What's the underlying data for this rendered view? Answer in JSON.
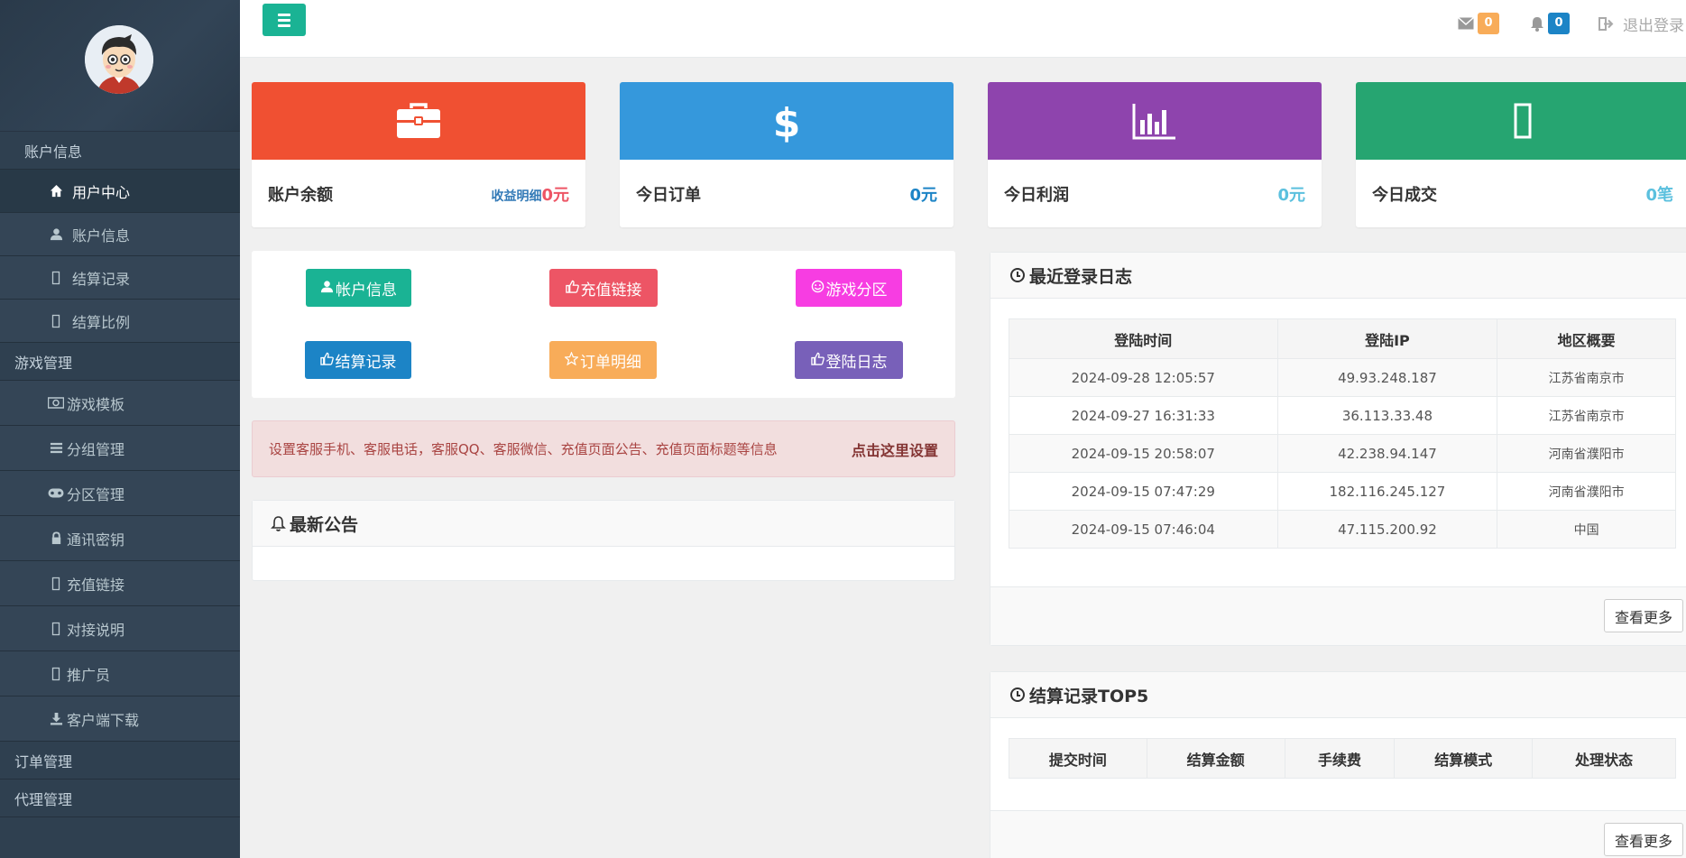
{
  "sidebar": {
    "items": [
      {
        "label": "账户信息",
        "icon": "",
        "type": "section"
      },
      {
        "label": "用户中心",
        "icon": "home-icon",
        "type": "sub-active"
      },
      {
        "label": "账户信息",
        "icon": "user-icon",
        "type": "sub"
      },
      {
        "label": "结算记录",
        "icon": "missing-glyph-icon",
        "type": "sub"
      },
      {
        "label": "结算比例",
        "icon": "missing-glyph-icon",
        "type": "sub"
      },
      {
        "label": "游戏管理",
        "icon": "",
        "type": "section"
      },
      {
        "label": "游戏模板",
        "icon": "money-icon",
        "type": "sub2"
      },
      {
        "label": "分组管理",
        "icon": "list-icon",
        "type": "sub2"
      },
      {
        "label": "分区管理",
        "icon": "gamepad-icon",
        "type": "sub2"
      },
      {
        "label": "通讯密钥",
        "icon": "lock-icon",
        "type": "sub2"
      },
      {
        "label": "充值链接",
        "icon": "missing-glyph-icon",
        "type": "sub2"
      },
      {
        "label": "对接说明",
        "icon": "missing-glyph-icon",
        "type": "sub2"
      },
      {
        "label": "推广员",
        "icon": "missing-glyph-icon",
        "type": "sub2"
      },
      {
        "label": "客户端下载",
        "icon": "download-icon",
        "type": "sub2"
      },
      {
        "label": "订单管理",
        "icon": "",
        "type": "section"
      },
      {
        "label": "代理管理",
        "icon": "",
        "type": "section"
      }
    ]
  },
  "topbar": {
    "mail_count": "0",
    "bell_count": "0",
    "logout_label": "退出登录"
  },
  "stats": [
    {
      "label": "账户余额",
      "detail_link": "收益明细",
      "value": "0元",
      "color": "#f05032",
      "value_color": "#ed5565",
      "icon": "briefcase-icon"
    },
    {
      "label": "今日订单",
      "value": "0元",
      "color": "#3598dc",
      "value_color": "#1c84c6",
      "icon": "dollar-icon"
    },
    {
      "label": "今日利润",
      "value": "0元",
      "color": "#8e44ad",
      "value_color": "#5bc0de",
      "icon": "bar-chart-icon"
    },
    {
      "label": "今日成交",
      "value": "0笔",
      "color": "#26a571",
      "value_color": "#5bc0de",
      "icon": "missing-glyph-icon"
    }
  ],
  "quick_links": [
    {
      "label": "帐户信息",
      "icon": "user-icon",
      "color": "#1ab394"
    },
    {
      "label": "充值链接",
      "icon": "thumbs-up-icon",
      "color": "#ed5565"
    },
    {
      "label": "游戏分区",
      "icon": "smile-icon",
      "color": "#f73de2"
    },
    {
      "label": "结算记录",
      "icon": "thumbs-up-icon",
      "color": "#1c84c6"
    },
    {
      "label": "订单明细",
      "icon": "star-icon",
      "color": "#f8ac59"
    },
    {
      "label": "登陆日志",
      "icon": "thumbs-up-icon",
      "color": "#7860b9"
    }
  ],
  "alert": {
    "text": "设置客服手机、客服电话，客服QQ、客服微信、充值页面公告、充值页面标题等信息",
    "link": "点击这里设置"
  },
  "notice": {
    "title": "最新公告"
  },
  "login_log": {
    "title": "最近登录日志",
    "headers": [
      "登陆时间",
      "登陆IP",
      "地区概要"
    ],
    "rows": [
      [
        "2024-09-28 12:05:57",
        "49.93.248.187",
        "江苏省南京市"
      ],
      [
        "2024-09-27 16:31:33",
        "36.113.33.48",
        "江苏省南京市"
      ],
      [
        "2024-09-15 20:58:07",
        "42.238.94.147",
        "河南省濮阳市"
      ],
      [
        "2024-09-15 07:47:29",
        "182.116.245.127",
        "河南省濮阳市"
      ],
      [
        "2024-09-15 07:46:04",
        "47.115.200.92",
        "中国"
      ]
    ],
    "more_label": "查看更多"
  },
  "settle_top": {
    "title": "结算记录TOP5",
    "headers": [
      "提交时间",
      "结算金额",
      "手续费",
      "结算模式",
      "处理状态"
    ],
    "more_label": "查看更多"
  }
}
